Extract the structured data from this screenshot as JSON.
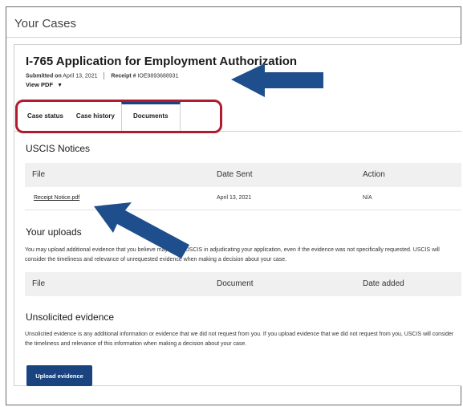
{
  "page": {
    "title": "Your Cases"
  },
  "case": {
    "form_title": "I-765 Application for Employment Authorization",
    "submitted_label": "Submitted on",
    "submitted_date": "April 13, 2021",
    "receipt_label": "Receipt #",
    "receipt_number": "IOE9893688931",
    "view_pdf": "View PDF"
  },
  "tabs": [
    {
      "label": "Case status",
      "active": false
    },
    {
      "label": "Case history",
      "active": false
    },
    {
      "label": "Documents",
      "active": true
    }
  ],
  "notices": {
    "heading": "USCIS Notices",
    "columns": [
      "File",
      "Date Sent",
      "Action"
    ],
    "rows": [
      {
        "file": "Receipt Notice.pdf",
        "date_sent": "April 13, 2021",
        "action": "N/A"
      }
    ]
  },
  "uploads": {
    "heading": "Your uploads",
    "description": "You may upload additional evidence that you believe may assist USCIS in adjudicating your application, even if the evidence was not specifically requested. USCIS will consider the timeliness and relevance of unrequested evidence when making a decision about your case.",
    "columns": [
      "File",
      "Document",
      "Date added"
    ]
  },
  "unsolicited": {
    "heading": "Unsolicited evidence",
    "description": "Unsolicited evidence is any additional information or evidence that we did not request from you. If you upload evidence that we did not request from you, USCIS will consider the timeliness and relevance of this information when making a decision about your case.",
    "button": "Upload evidence"
  },
  "annotations": {
    "arrow_color": "#1f4e8c",
    "highlight_color": "#b01c2e"
  },
  "icons": {
    "dropdown": "caret-down-icon"
  }
}
